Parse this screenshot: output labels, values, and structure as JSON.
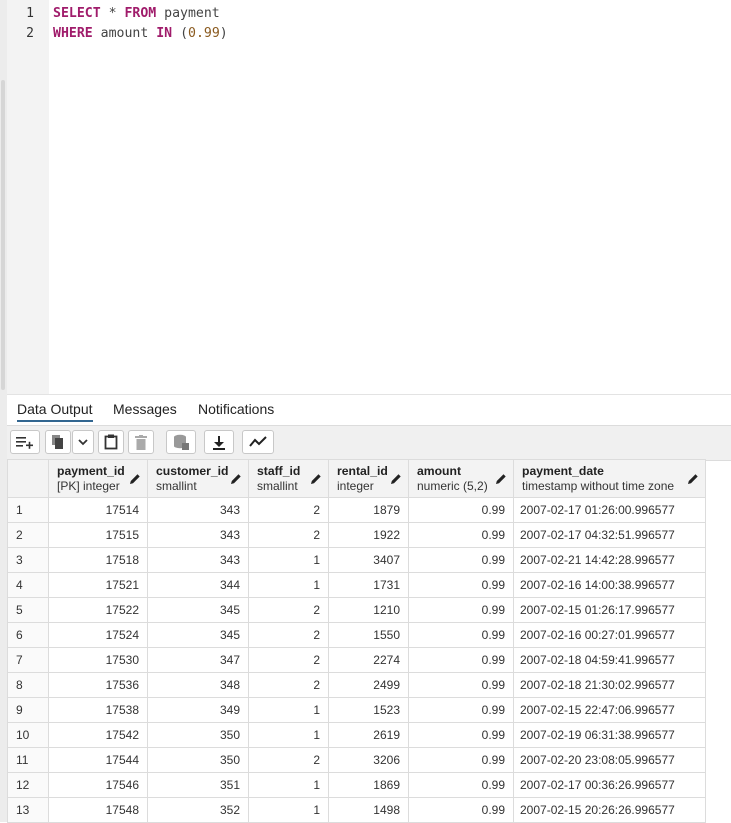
{
  "editor": {
    "lines": [
      {
        "number": "1",
        "tokens": [
          {
            "text": "SELECT",
            "kind": "kw"
          },
          {
            "text": " * ",
            "kind": "op"
          },
          {
            "text": "FROM",
            "kind": "kw"
          },
          {
            "text": " payment",
            "kind": "op"
          }
        ]
      },
      {
        "number": "2",
        "tokens": [
          {
            "text": "WHERE",
            "kind": "kw"
          },
          {
            "text": " amount ",
            "kind": "op"
          },
          {
            "text": "IN",
            "kind": "kw"
          },
          {
            "text": " (",
            "kind": "op"
          },
          {
            "text": "0.99",
            "kind": "num"
          },
          {
            "text": ")",
            "kind": "op"
          }
        ]
      }
    ]
  },
  "tabs": [
    {
      "label": "Data Output",
      "active": true
    },
    {
      "label": "Messages",
      "active": false
    },
    {
      "label": "Notifications",
      "active": false
    }
  ],
  "toolbar": {
    "buttons": [
      "add-row-icon",
      "copy-icon",
      "chevron-down-icon",
      "paste-icon",
      "delete-icon",
      "save-data-icon",
      "download-icon",
      "graph-icon"
    ]
  },
  "grid": {
    "columns": [
      {
        "name": "payment_id",
        "type": "[PK] integer"
      },
      {
        "name": "customer_id",
        "type": "smallint"
      },
      {
        "name": "staff_id",
        "type": "smallint"
      },
      {
        "name": "rental_id",
        "type": "integer"
      },
      {
        "name": "amount",
        "type": "numeric (5,2)"
      },
      {
        "name": "payment_date",
        "type": "timestamp without time zone"
      }
    ],
    "rows": [
      [
        "1",
        "17514",
        "343",
        "2",
        "1879",
        "0.99",
        "2007-02-17 01:26:00.996577"
      ],
      [
        "2",
        "17515",
        "343",
        "2",
        "1922",
        "0.99",
        "2007-02-17 04:32:51.996577"
      ],
      [
        "3",
        "17518",
        "343",
        "1",
        "3407",
        "0.99",
        "2007-02-21 14:42:28.996577"
      ],
      [
        "4",
        "17521",
        "344",
        "1",
        "1731",
        "0.99",
        "2007-02-16 14:00:38.996577"
      ],
      [
        "5",
        "17522",
        "345",
        "2",
        "1210",
        "0.99",
        "2007-02-15 01:26:17.996577"
      ],
      [
        "6",
        "17524",
        "345",
        "2",
        "1550",
        "0.99",
        "2007-02-16 00:27:01.996577"
      ],
      [
        "7",
        "17530",
        "347",
        "2",
        "2274",
        "0.99",
        "2007-02-18 04:59:41.996577"
      ],
      [
        "8",
        "17536",
        "348",
        "2",
        "2499",
        "0.99",
        "2007-02-18 21:30:02.996577"
      ],
      [
        "9",
        "17538",
        "349",
        "1",
        "1523",
        "0.99",
        "2007-02-15 22:47:06.996577"
      ],
      [
        "10",
        "17542",
        "350",
        "1",
        "2619",
        "0.99",
        "2007-02-19 06:31:38.996577"
      ],
      [
        "11",
        "17544",
        "350",
        "2",
        "3206",
        "0.99",
        "2007-02-20 23:08:05.996577"
      ],
      [
        "12",
        "17546",
        "351",
        "1",
        "1869",
        "0.99",
        "2007-02-17 00:36:26.996577"
      ],
      [
        "13",
        "17548",
        "352",
        "1",
        "1498",
        "0.99",
        "2007-02-15 20:26:26.996577"
      ]
    ]
  }
}
